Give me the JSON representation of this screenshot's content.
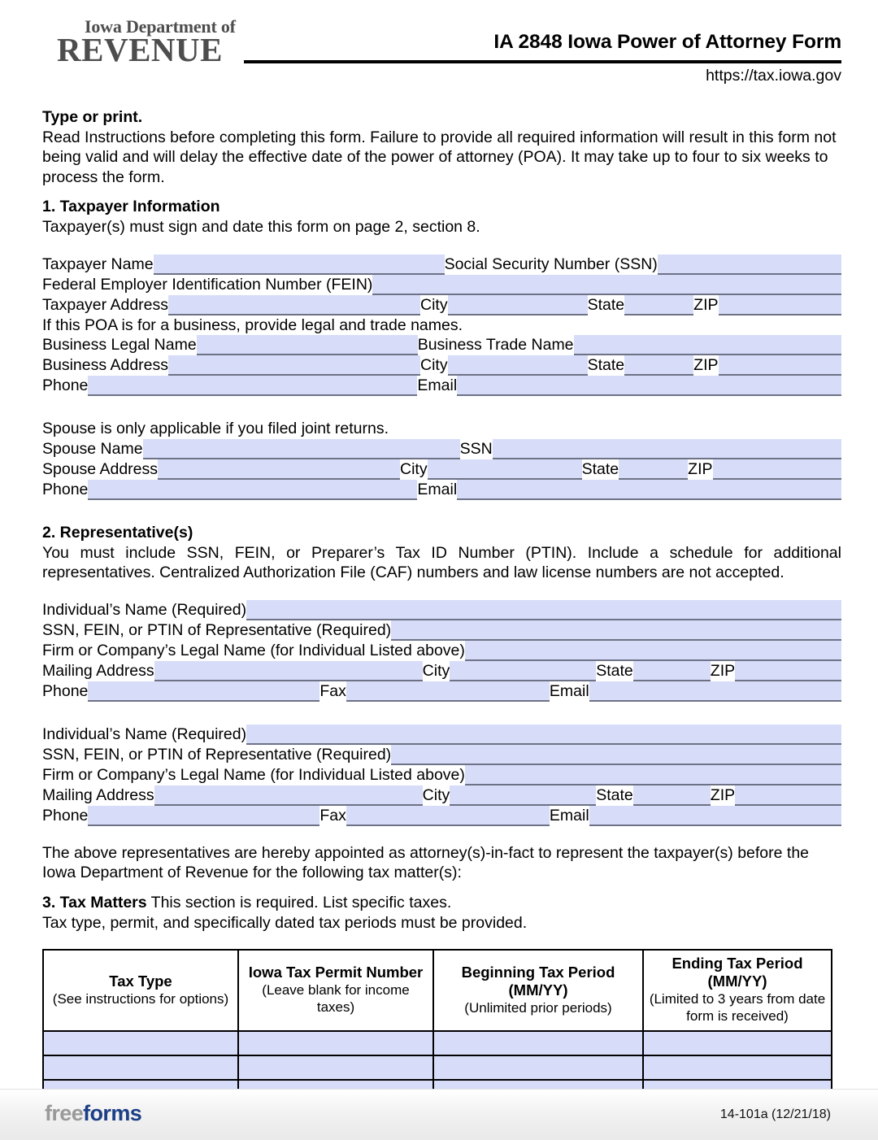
{
  "header": {
    "logo_line1": "Iowa Department of",
    "logo_line2": "REVENUE",
    "title": "IA 2848 Iowa Power of Attorney Form",
    "url": "https://tax.iowa.gov"
  },
  "instructions": {
    "type_or_print": "Type or print.",
    "body": "Read Instructions before completing this form. Failure to provide all required information will result in this form not being valid and will delay the effective date of the power of attorney (POA). It may take up to four to six weeks to process the form."
  },
  "section1": {
    "heading": "1.  Taxpayer Information",
    "subtext": "Taxpayer(s) must sign and date this form on page 2, section 8.",
    "labels": {
      "taxpayer_name": "Taxpayer Name",
      "ssn": "Social Security Number (SSN)",
      "fein": "Federal Employer Identification Number (FEIN)",
      "taxpayer_address": "Taxpayer Address",
      "city": "City",
      "state": "State",
      "zip": "ZIP",
      "business_note": "If this POA is for a business, provide legal and trade names.",
      "business_legal_name": "Business Legal Name",
      "business_trade_name": "Business Trade Name",
      "business_address": "Business Address",
      "phone": "Phone",
      "email": "Email"
    },
    "spouse": {
      "note": "Spouse is only applicable if you filed joint returns.",
      "name": "Spouse Name",
      "ssn": "SSN",
      "address": "Spouse Address",
      "city": "City",
      "state": "State",
      "zip": "ZIP",
      "phone": "Phone",
      "email": "Email"
    },
    "values": {
      "taxpayer_name": "",
      "ssn": "",
      "fein": "",
      "taxpayer_address": "",
      "taxpayer_city": "",
      "taxpayer_state": "",
      "taxpayer_zip": "",
      "business_legal_name": "",
      "business_trade_name": "",
      "business_address": "",
      "business_city": "",
      "business_state": "",
      "business_zip": "",
      "phone": "",
      "email": "",
      "spouse_name": "",
      "spouse_ssn": "",
      "spouse_address": "",
      "spouse_city": "",
      "spouse_state": "",
      "spouse_zip": "",
      "spouse_phone": "",
      "spouse_email": ""
    }
  },
  "section2": {
    "heading": "2. Representative(s)",
    "body": "You must include SSN, FEIN, or Preparer’s Tax ID Number (PTIN). Include a schedule for additional representatives. Centralized Authorization File (CAF) numbers and law license numbers are not accepted.",
    "labels": {
      "individual_name": "Individual’s Name (Required)",
      "ssn_fein_ptin": "SSN, FEIN, or PTIN of Representative (Required)",
      "firm_name": "Firm or Company’s Legal Name (for Individual Listed above)",
      "mailing_address": "Mailing Address",
      "city": "City",
      "state": "State",
      "zip": "ZIP",
      "phone": "Phone",
      "fax": "Fax",
      "email": "Email"
    },
    "rep1": {
      "individual_name": "",
      "ssn_fein_ptin": "",
      "firm_name": "",
      "mailing_address": "",
      "city": "",
      "state": "",
      "zip": "",
      "phone": "",
      "fax": "",
      "email": ""
    },
    "rep2": {
      "individual_name": "",
      "ssn_fein_ptin": "",
      "firm_name": "",
      "mailing_address": "",
      "city": "",
      "state": "",
      "zip": "",
      "phone": "",
      "fax": "",
      "email": ""
    },
    "appointment_text": "The above representatives are hereby appointed as attorney(s)-in-fact to represent the taxpayer(s) before the Iowa Department of Revenue for the following tax matter(s):"
  },
  "section3": {
    "heading_bold": "3. Tax Matters",
    "heading_rest": " This section is required. List specific taxes.",
    "subtext": "Tax type, permit, and specifically dated tax periods must be provided.",
    "table": {
      "columns": [
        {
          "main": "Tax Type",
          "sub": "(See instructions for options)"
        },
        {
          "main": "Iowa Tax Permit Number",
          "sub": "(Leave blank for income taxes)"
        },
        {
          "main": "Beginning Tax Period (MM/YY)",
          "sub": "(Unlimited prior periods)"
        },
        {
          "main": "Ending Tax Period (MM/YY)",
          "sub": "(Limited to 3 years from date form is received)"
        }
      ],
      "rows": [
        [
          "",
          "",
          "",
          ""
        ],
        [
          "",
          "",
          "",
          ""
        ],
        [
          "",
          "",
          "",
          ""
        ],
        [
          "",
          "",
          "",
          ""
        ]
      ]
    }
  },
  "footer": {
    "logo_part1": "free",
    "logo_part2": "forms",
    "form_code": "14-101a (12/21/18)"
  },
  "colors": {
    "field_fill": "#d7ddf9",
    "field_rule": "#6e7286",
    "logo_gray": "#4d4d4d",
    "ff_blue": "#1c3f86"
  }
}
